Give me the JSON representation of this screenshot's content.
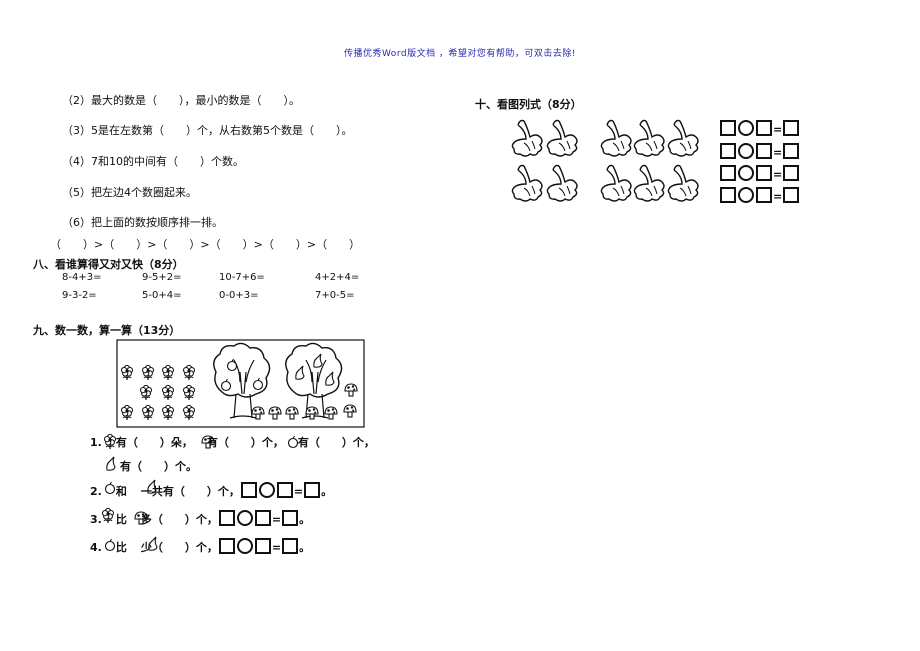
{
  "header": {
    "note": "传播优秀Word版文档 ，希望对您有帮助，可双击去除!"
  },
  "section7": {
    "items": [
      "（2）最大的数是（　　），最小的数是（　　）。",
      "（3）5是在左数第（　　）个，从右数第5个数是（　　）。",
      "（4）7和10的中间有（　　）个数。",
      "（5）把左边4个数圈起来。",
      "（6）把上面的数按顺序排一排。"
    ],
    "order_row": "（　　）>（　　）>（　　）>（　　）>（　　）>（　　）"
  },
  "section8": {
    "title": "八、看谁算得又对又快（8分）",
    "rows": [
      [
        "8-4+3=",
        "9-5+2=",
        "10-7+6=",
        "4+2+4="
      ],
      [
        "9-3-2=",
        "5-0+4=",
        "0-0+3=",
        "7+0-5="
      ]
    ]
  },
  "section9": {
    "title": "九、数一数，算一算（13分）",
    "q1_num": "1.",
    "q1_a": "有（　　）朵，",
    "q1_b": "有（　　）个，",
    "q1_c": "有（　　）个，",
    "q1_d": "有（　　）个。",
    "q2_num": "2.",
    "q2_text": "和",
    "q2_tail": "一共有（　　）个，",
    "q3_num": "3.",
    "q3_text": "比",
    "q3_tail": "多（　　）个，",
    "q4_num": "4.",
    "q4_text": "比",
    "q4_tail": "少（　　）个，",
    "eq_sign": "=",
    "period": "。"
  },
  "section10": {
    "title": "十、看图列式（8分）",
    "eq_sign": "="
  }
}
